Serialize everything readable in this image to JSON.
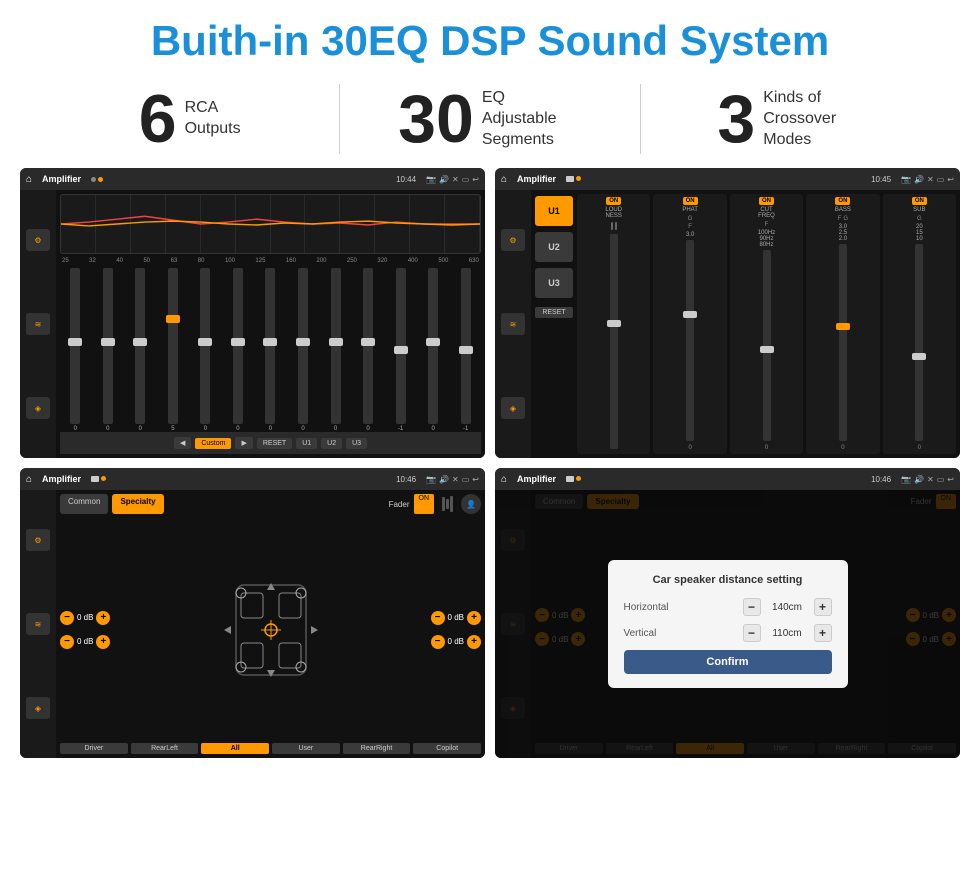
{
  "page": {
    "title": "Buith-in 30EQ DSP Sound System"
  },
  "stats": [
    {
      "number": "6",
      "text": "RCA\nOutputs"
    },
    {
      "number": "30",
      "text": "EQ Adjustable\nSegments"
    },
    {
      "number": "3",
      "text": "Kinds of\nCrossover Modes"
    }
  ],
  "screens": [
    {
      "id": "screen1",
      "title": "Amplifier",
      "time": "10:44",
      "type": "eq"
    },
    {
      "id": "screen2",
      "title": "Amplifier",
      "time": "10:45",
      "type": "amp"
    },
    {
      "id": "screen3",
      "title": "Amplifier",
      "time": "10:46",
      "type": "fader"
    },
    {
      "id": "screen4",
      "title": "Amplifier",
      "time": "10:46",
      "type": "dialog"
    }
  ],
  "eq": {
    "freqs": [
      "25",
      "32",
      "40",
      "50",
      "63",
      "80",
      "100",
      "125",
      "160",
      "200",
      "250",
      "320",
      "400",
      "500",
      "630"
    ],
    "values": [
      "0",
      "0",
      "0",
      "5",
      "0",
      "0",
      "0",
      "0",
      "0",
      "0",
      "-1",
      "0",
      "-1"
    ],
    "buttons": [
      "Custom",
      "RESET",
      "U1",
      "U2",
      "U3"
    ]
  },
  "amp": {
    "channels": [
      {
        "label": "LOUDNESS",
        "on": true
      },
      {
        "label": "PHAT",
        "on": true
      },
      {
        "label": "CUT FREQ",
        "on": true
      },
      {
        "label": "BASS",
        "on": true
      },
      {
        "label": "SUB",
        "on": true
      }
    ],
    "uButtons": [
      "U1",
      "U2",
      "U3"
    ]
  },
  "fader": {
    "tabs": [
      "Common",
      "Specialty"
    ],
    "activeTab": "Specialty",
    "faderLabel": "Fader",
    "faderOn": "ON",
    "volumes": [
      {
        "val": "0 dB"
      },
      {
        "val": "0 dB"
      },
      {
        "val": "0 dB"
      },
      {
        "val": "0 dB"
      }
    ],
    "bottomBtns": [
      "Driver",
      "RearLeft",
      "All",
      "User",
      "RearRight",
      "Copilot"
    ]
  },
  "dialog": {
    "title": "Car speaker distance setting",
    "rows": [
      {
        "label": "Horizontal",
        "value": "140cm"
      },
      {
        "label": "Vertical",
        "value": "110cm"
      }
    ],
    "confirmLabel": "Confirm"
  }
}
